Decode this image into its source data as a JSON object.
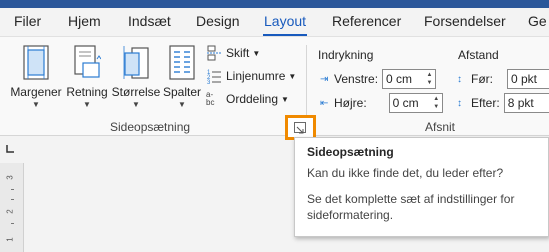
{
  "tabs": [
    "Filer",
    "Hjem",
    "Indsæt",
    "Design",
    "Layout",
    "Referencer",
    "Forsendelser",
    "Ge"
  ],
  "active_tab": "Layout",
  "colors": {
    "accent": "#185abd",
    "highlight": "#f08a00",
    "titlebar": "#2b579a"
  },
  "page_setup": {
    "buttons": [
      {
        "label": "Margener",
        "icon": "margins-icon"
      },
      {
        "label": "Retning",
        "icon": "orientation-icon"
      },
      {
        "label": "Størrelse",
        "icon": "size-icon"
      },
      {
        "label": "Spalter",
        "icon": "columns-icon"
      }
    ],
    "small_buttons": [
      {
        "label": "Skift",
        "icon": "breaks-icon"
      },
      {
        "label": "Linjenumre",
        "icon": "line-numbers-icon"
      },
      {
        "label": "Orddeling",
        "icon": "hyphenation-icon"
      }
    ],
    "hyphenation_icon_text": "a-\nbc",
    "group_label": "Sideopsætning"
  },
  "paragraph": {
    "indent_header": "Indrykning",
    "spacing_header": "Afstand",
    "left_label": "Venstre:",
    "left_value": "0 cm",
    "right_label": "Højre:",
    "right_value": "0 cm",
    "before_label": "Før:",
    "before_value": "0 pkt",
    "after_label": "Efter:",
    "after_value": "8 pkt",
    "group_label": "Afsnit"
  },
  "ruler": {
    "numbers": [
      "3",
      "2",
      "1"
    ]
  },
  "tooltip": {
    "title": "Sideopsætning",
    "line1": "Kan du ikke finde det, du leder efter?",
    "description": "Se det komplette sæt af indstillinger for sideformatering."
  }
}
